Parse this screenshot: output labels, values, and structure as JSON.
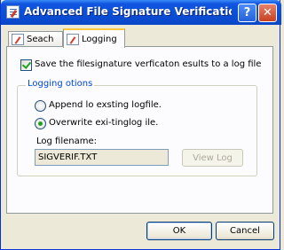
{
  "window": {
    "title": "Advanced File Signature Verification Setti...",
    "help_label": "?",
    "close_label": "✕",
    "icon": "signature-verification-icon"
  },
  "tabs": [
    {
      "label": "Seach",
      "icon": "search-tab-icon",
      "active": false
    },
    {
      "label": "Logging",
      "icon": "logging-tab-icon",
      "active": true
    }
  ],
  "logging": {
    "save_checkbox_label": "Save the filesignature verficaton esults to a log file",
    "save_checked": true,
    "group_legend": "Logging otions",
    "options": [
      {
        "label": "Append lo exsting logfile.",
        "selected": false
      },
      {
        "label": "Overwrite exi-tinglog ile.",
        "selected": true
      }
    ],
    "filename_label": "Log filename:",
    "filename_value": "SIGVERIF.TXT",
    "view_log_label": "View Log"
  },
  "footer": {
    "ok_label": "OK",
    "cancel_label": "Cancel"
  }
}
